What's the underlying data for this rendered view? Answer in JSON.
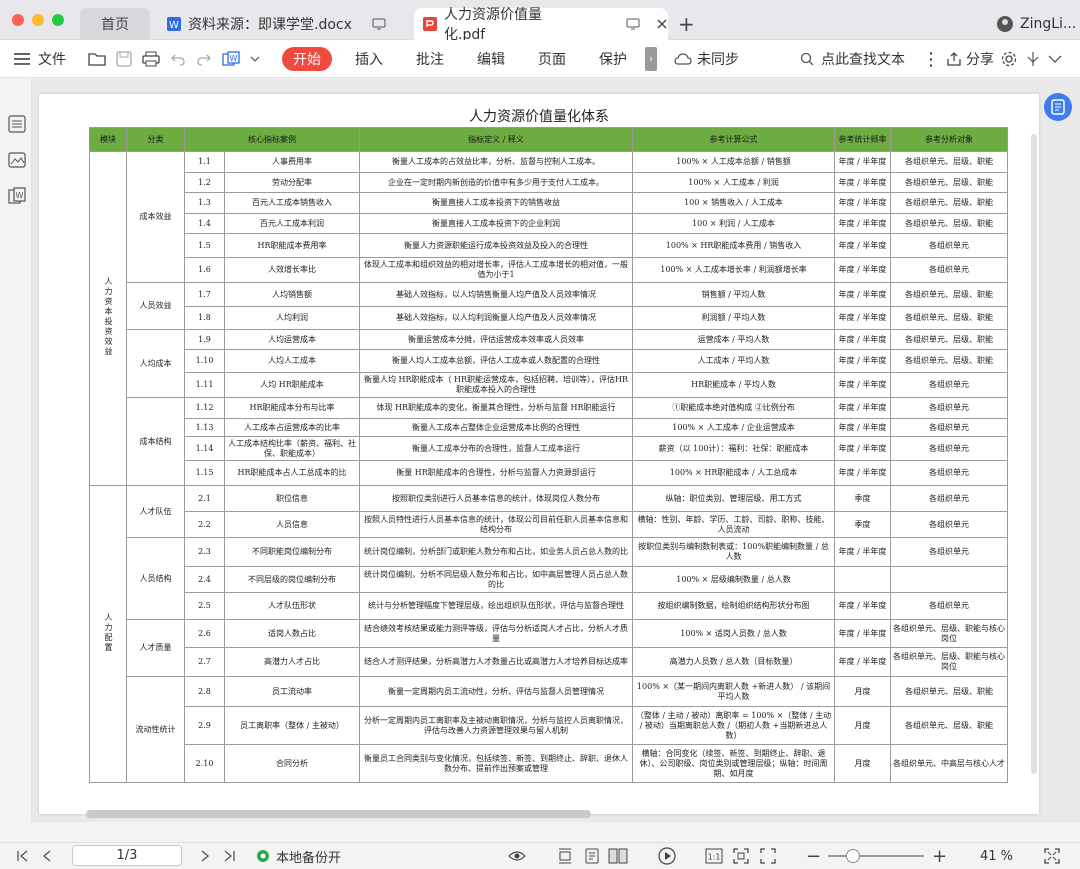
{
  "tabs": {
    "home": "首页",
    "doc": "资料来源：即课学堂.docx",
    "pdf": "人力资源价值量化.pdf"
  },
  "user": "ZingLi...",
  "toolbar": {
    "menu": "文件",
    "start": "开始",
    "insert": "插入",
    "comment": "批注",
    "edit": "编辑",
    "page": "页面",
    "protect": "保护",
    "sync": "未同步",
    "search": "点此查找文本",
    "share": "分享"
  },
  "doc": {
    "title": "人力资源价值量化体系",
    "headers": [
      "模块",
      "分类",
      "核心指标案例",
      "指标定义    /    释义",
      "参考计算公式",
      "参考统计频率",
      "参考分析对象"
    ],
    "modules": [
      "人力资本投资效益",
      "人力配置"
    ],
    "categories": [
      "成本效益",
      "人员效益",
      "人均成本",
      "成本结构",
      "人才队伍",
      "人员结构",
      "人才质量",
      "流动性统计"
    ],
    "rows": [
      {
        "no": "1.1",
        "name": "人事费用率",
        "def": "衡量人工成本的占效益比率，分析、监督与控制人工成本。",
        "formula": "100%  × 人工成本总额      /  销售额",
        "freq": "年度 / 半年度",
        "target": "各组织单元、层级、职能"
      },
      {
        "no": "1.2",
        "name": "劳动分配率",
        "def": "企业在一定时期内新创造的价值中有多少用于支付人工成本。",
        "formula": "100%  × 人工成本      /  利润",
        "freq": "年度 / 半年度",
        "target": "各组织单元、层级、职能"
      },
      {
        "no": "1.3",
        "name": "百元人工成本销售收入",
        "def": "衡量直接人工成本投资下的销售收益",
        "formula": "100  × 销售收入      /  人工成本",
        "freq": "年度 / 半年度",
        "target": "各组织单元、层级、职能"
      },
      {
        "no": "1.4",
        "name": "百元人工成本利润",
        "def": "衡量直接人工成本投资下的企业利润",
        "formula": "100  × 利润      /  人工成本",
        "freq": "年度 / 半年度",
        "target": "各组织单元、层级、职能"
      },
      {
        "no": "1.5",
        "name": "HR职能成本费用率",
        "def": "衡量人力资源职能运行成本投资效益及投入的合理性",
        "formula": "100%  × HR职能成本费用      /  销售收入",
        "freq": "年度 / 半年度",
        "target": "各组织单元"
      },
      {
        "no": "1.6",
        "name": "人效增长率比",
        "def": "体现人工成本和组织效益的相对增长率，评估人工成本增长的相对值，一般值为小于1",
        "formula": "100%  × 人工成本增长率  /  利润额增长率",
        "freq": "年度 / 半年度",
        "target": "各组织单元"
      },
      {
        "no": "1.7",
        "name": "人均销售额",
        "def": "基础人效指标，以人均销售衡量人均产值及人员效率情况",
        "formula": "销售额    /  平均人数",
        "freq": "年度 / 半年度",
        "target": "各组织单元、层级、职能"
      },
      {
        "no": "1.8",
        "name": "人均利润",
        "def": "基础人效指标，以人均利润衡量人均产值及人员效率情况",
        "formula": "利润额    /  平均人数",
        "freq": "年度 / 半年度",
        "target": "各组织单元、层级、职能"
      },
      {
        "no": "1.9",
        "name": "人均运营成本",
        "def": "衡量运营成本分摊，评估运营成本效率或人员效率",
        "formula": "运营成本    /  平均人数",
        "freq": "年度 / 半年度",
        "target": "各组织单元、层级、职能"
      },
      {
        "no": "1.10",
        "name": "人均人工成本",
        "def": "衡量人均人工成本总额，评估人工成本或人数配置的合理性",
        "formula": "人工成本    /  平均人数",
        "freq": "年度 / 半年度",
        "target": "各组织单元、层级、职能"
      },
      {
        "no": "1.11",
        "name": "人均  HR职能成本",
        "def": "衡量人均  HR职能成本（  HR职能运营成本，包括招聘、培训等），评估HR职能成本投入的合理性",
        "formula": "HR职能成本  /  平均人数",
        "freq": "年度 / 半年度",
        "target": "各组织单元"
      },
      {
        "no": "1.12",
        "name": "HR职能成本分布与比率",
        "def": "体现  HR职能成本的变化，衡量其合理性，分析与监督              HR职能运行",
        "formula": "①职能成本绝对值构成 ②比例分布",
        "freq": "年度 / 半年度",
        "target": "各组织单元"
      },
      {
        "no": "1.13",
        "name": "人工成本占运营成本的比率",
        "def": "衡量人工成本占整体企业运营成本比例的合理性",
        "formula": "100%  × 人工成本      /  企业运营成本",
        "freq": "年度 / 半年度",
        "target": "各组织单元"
      },
      {
        "no": "1.14",
        "name": "人工成本结构比率（薪资、福利、社保、职能成本）",
        "def": "衡量人工成本分布的合理性，监督人工成本运行",
        "formula": "薪资（以  100计）：福利：社保：职能成本",
        "freq": "年度 / 半年度",
        "target": "各组织单元"
      },
      {
        "no": "1.15",
        "name": "HR职能成本占人工总成本的比",
        "def": "衡量  HR职能成本的合理性，分析与监督人力资源部运行",
        "formula": "100%  ×  HR职能成本      /  人工总成本",
        "freq": "年度 / 半年度",
        "target": "各组织单元"
      },
      {
        "no": "2.1",
        "name": "职位信息",
        "def": "按照职位类别进行人员基本信息的统计，体现岗位人数分布",
        "formula": "纵轴：职位类别、管理层级、用工方式",
        "freq": "季度",
        "target": "各组织单元"
      },
      {
        "no": "2.2",
        "name": "人员信息",
        "def": "按照人员特性进行人员基本信息的统计，体现公司目前任职人员基本信息和结构分布",
        "formula": "横轴：性别、年龄、学历、工龄、司龄、职称、技能、人员流动",
        "freq": "季度",
        "target": "各组织单元"
      },
      {
        "no": "2.3",
        "name": "不同职能岗位编制分布",
        "def": "统计岗位编制，分析部门或职能人数分布和占比，如业务人员占总人数的比",
        "formula": "按职位类别与编制数制表或：100%职能编制数量  /  总人数",
        "freq": "年度 / 半年度",
        "target": "各组织单元"
      },
      {
        "no": "2.4",
        "name": "不同层级的岗位编制分布",
        "def": "统计岗位编制，分析不同层级人数分布和占比，如中高层管理人员占总人数的比",
        "formula": "100%  × 层级编制数量  /  总人数",
        "freq": "",
        "target": ""
      },
      {
        "no": "2.5",
        "name": "人才队伍形状",
        "def": "统计与分析管理幅度下管理层级，绘出组织队伍形状，评估与监督合理性",
        "formula": "按组织编制数据，绘制组织结构形状分布图",
        "freq": "年度 / 半年度",
        "target": "各组织单元"
      },
      {
        "no": "2.6",
        "name": "适岗人数占比",
        "def": "结合绩效考核结果或能力测评等级，评估与分析适岗人才占比，分析人才质量",
        "formula": "100%  × 适岗人员数  /  总人数",
        "freq": "年度 / 半年度",
        "target": "各组织单元、层级、职能与核心岗位"
      },
      {
        "no": "2.7",
        "name": "高潜力人才占比",
        "def": "结合人才测评结果，分析高潜力人才数量占比或高潜力人才培养目标达成率",
        "formula": "高潜力人员数  /  总人数（目标数量）",
        "freq": "年度 / 半年度",
        "target": "各组织单元、层级、职能与核心岗位"
      },
      {
        "no": "2.8",
        "name": "员工流动率",
        "def": "衡量一定周期内员工流动性，分析、评估与监督人员管理情况",
        "formula": "100%  ×（某一期间内离职人数  +新进人数）  /  该期间平均人数",
        "freq": "月度",
        "target": "各组织单元、层级、职能"
      },
      {
        "no": "2.9",
        "name": "员工离职率（整体      /  主被动）",
        "def": "分析一定周期内员工离职率及主被动离职情况，分析与监控人员离职情况，评估与改善人力资源管理效果与留人机制",
        "formula": "（整体 / 主动 / 被动）离职率  =      100%  ×（整体 / 主动 / 被动）当期离职总人数 /（期初人数  +当期新进总人数）",
        "freq": "月度",
        "target": "各组织单元、层级、职能"
      },
      {
        "no": "2.10",
        "name": "合同分析",
        "def": "衡量员工合同类别与变化情况，包括续签、新签、到期终止、辞职、退休人数分布、提前作出预案或管理",
        "formula": "横轴：合同变化（续签、新签、到期终止、辞职、退休）、公司职级、岗位类别或管理层级；纵轴：时间周期、如月度",
        "freq": "月度",
        "target": "各组织单元、中高层与核心人才"
      }
    ]
  },
  "status": {
    "page": "1/3",
    "backup": "本地备份开",
    "zoom": "41 %"
  }
}
